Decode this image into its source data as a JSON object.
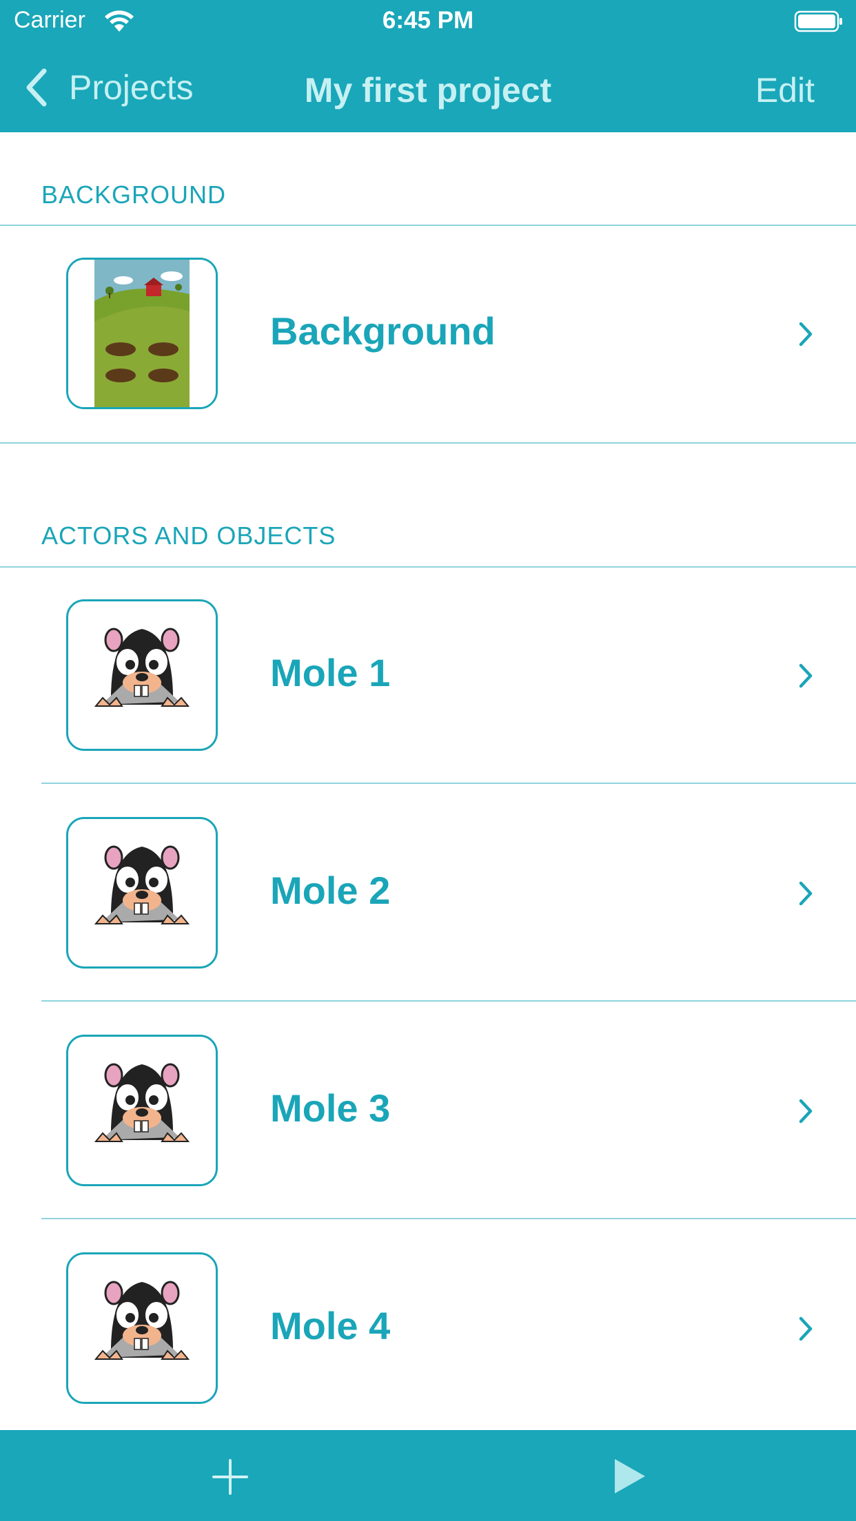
{
  "status_bar": {
    "carrier": "Carrier",
    "time": "6:45 PM",
    "icons": [
      "wifi-icon",
      "battery-icon"
    ]
  },
  "nav": {
    "back_label": "Projects",
    "title": "My first project",
    "edit_label": "Edit"
  },
  "sections": {
    "background": {
      "header": "BACKGROUND",
      "items": [
        {
          "label": "Background",
          "thumbnail": "farm-background-image"
        }
      ]
    },
    "actors": {
      "header": "ACTORS AND OBJECTS",
      "items": [
        {
          "label": "Mole 1",
          "thumbnail": "mole-image"
        },
        {
          "label": "Mole 2",
          "thumbnail": "mole-image"
        },
        {
          "label": "Mole 3",
          "thumbnail": "mole-image"
        },
        {
          "label": "Mole 4",
          "thumbnail": "mole-image"
        }
      ]
    }
  },
  "toolbar": {
    "icons": [
      "plus-icon",
      "play-icon"
    ]
  },
  "colors": {
    "accent": "#19a7b9",
    "accent_text": "#1aa5b8",
    "nav_text": "#c6f0f3",
    "separator": "#8fd3dc"
  }
}
